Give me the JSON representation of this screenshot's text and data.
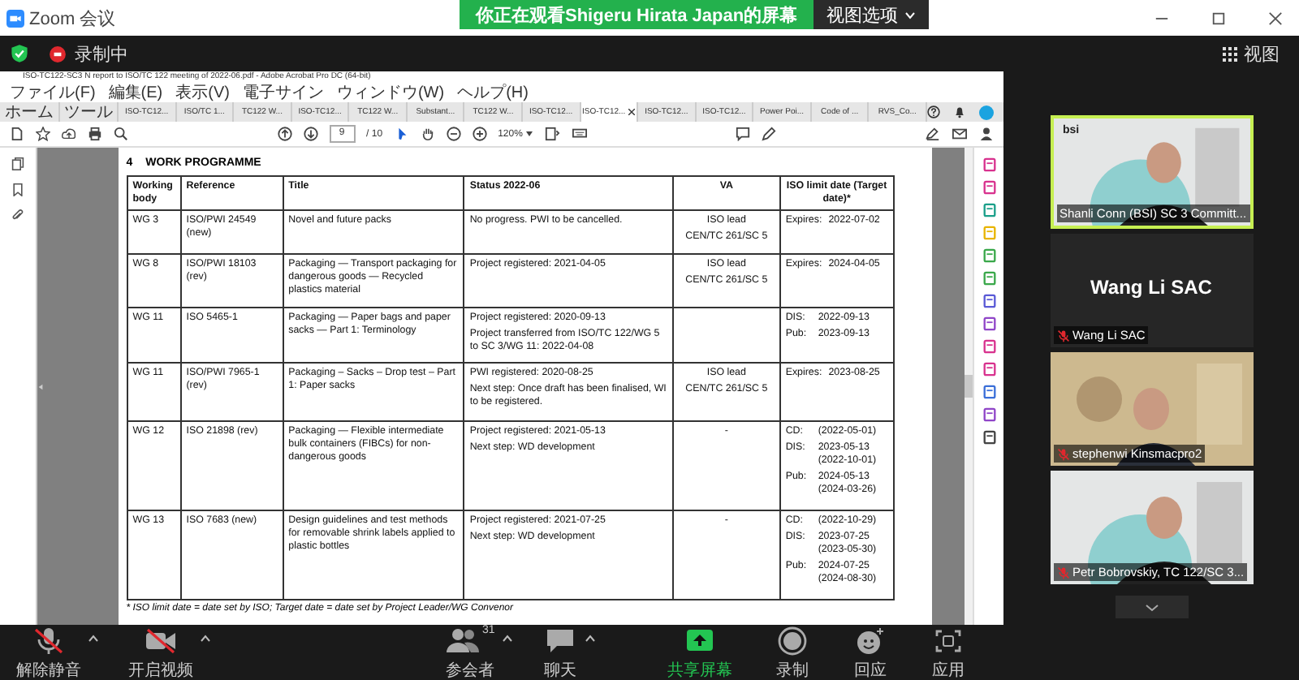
{
  "zoom_window": {
    "title": "Zoom 会议",
    "banner": "你正在观看Shigeru Hirata Japan的屏幕",
    "view_options": "视图选项",
    "recording": "录制中",
    "view": "视图"
  },
  "acrobat": {
    "title": "ISO-TC122-SC3 N report to ISO/TC 122 meeting of 2022-06.pdf - Adobe Acrobat Pro DC (64-bit)",
    "menus": [
      "ファイル(F)",
      "編集(E)",
      "表示(V)",
      "電子サイン",
      "ウィンドウ(W)",
      "ヘルプ(H)"
    ],
    "tabs": [
      {
        "label": "ホーム",
        "selected": false,
        "kind": "home"
      },
      {
        "label": "ツール",
        "selected": false,
        "kind": "home"
      },
      {
        "label": "ISO-TC12...",
        "selected": false,
        "kind": "doc"
      },
      {
        "label": "ISO/TC 1...",
        "selected": false,
        "kind": "doc"
      },
      {
        "label": "TC122 W...",
        "selected": false,
        "kind": "doc"
      },
      {
        "label": "ISO-TC12...",
        "selected": false,
        "kind": "doc"
      },
      {
        "label": "TC122 W...",
        "selected": false,
        "kind": "doc"
      },
      {
        "label": "Substant...",
        "selected": false,
        "kind": "doc"
      },
      {
        "label": "TC122 W...",
        "selected": false,
        "kind": "doc"
      },
      {
        "label": "ISO-TC12...",
        "selected": false,
        "kind": "doc"
      },
      {
        "label": "ISO-TC12...",
        "selected": true,
        "kind": "doc"
      },
      {
        "label": "ISO-TC12...",
        "selected": false,
        "kind": "doc"
      },
      {
        "label": "ISO-TC12...",
        "selected": false,
        "kind": "doc"
      },
      {
        "label": "Power Poi...",
        "selected": false,
        "kind": "doc"
      },
      {
        "label": "Code of ...",
        "selected": false,
        "kind": "doc"
      },
      {
        "label": "RVS_Co...",
        "selected": false,
        "kind": "doc"
      }
    ],
    "page_current": "9",
    "page_total": "/ 10",
    "zoom": "120%"
  },
  "document": {
    "heading_number": "4",
    "heading": "WORK PROGRAMME",
    "columns": [
      "Working body",
      "Reference",
      "Title",
      "Status 2022-06",
      "VA",
      "ISO limit date (Target date)*"
    ],
    "rows": [
      {
        "working_body": "WG 3",
        "reference": "ISO/PWI 24549 (new)",
        "title": "Novel and future packs",
        "status": [
          "No progress. PWI to be cancelled."
        ],
        "va": [
          "ISO lead",
          "CEN/TC 261/SC 5"
        ],
        "dates": [
          {
            "label": "Expires:",
            "value": "2022-07-02"
          }
        ]
      },
      {
        "working_body": "WG 8",
        "reference": "ISO/PWI 18103 (rev)",
        "title": "Packaging — Transport packaging for dangerous goods — Recycled plastics material",
        "status": [
          "Project registered: 2021-04-05"
        ],
        "va": [
          "ISO lead",
          "CEN/TC 261/SC 5"
        ],
        "dates": [
          {
            "label": "Expires:",
            "value": "2024-04-05"
          }
        ]
      },
      {
        "working_body": "WG 11",
        "reference": "ISO 5465-1",
        "title": "Packaging — Paper bags and paper sacks — Part 1: Terminology",
        "status": [
          "Project registered: 2020-09-13",
          "Project transferred from ISO/TC 122/WG 5 to SC 3/WG 11: 2022-04-08"
        ],
        "va": [],
        "dates": [
          {
            "label": "DIS:",
            "value": "2022-09-13"
          },
          {
            "label": "Pub:",
            "value": "2023-09-13"
          }
        ]
      },
      {
        "working_body": "WG 11",
        "reference": "ISO/PWI 7965-1 (rev)",
        "title": "Packaging – Sacks – Drop test – Part 1: Paper sacks",
        "status": [
          "PWI registered: 2020-08-25",
          "Next step: Once draft has been finalised, WI to be registered."
        ],
        "va": [
          "ISO lead",
          "CEN/TC 261/SC 5"
        ],
        "dates": [
          {
            "label": "Expires:",
            "value": "2023-08-25"
          }
        ]
      },
      {
        "working_body": "WG 12",
        "reference": "ISO 21898 (rev)",
        "title": "Packaging — Flexible intermediate bulk containers (FIBCs) for non-dangerous goods",
        "status": [
          "Project registered: 2021-05-13",
          "Next step: WD development"
        ],
        "va": [
          "-"
        ],
        "dates": [
          {
            "label": "CD:",
            "value": "(2022-05-01)"
          },
          {
            "label": "DIS:",
            "value": "2023-05-13",
            "target": "(2022-10-01)"
          },
          {
            "label": "Pub:",
            "value": "2024-05-13",
            "target": "(2024-03-26)"
          }
        ]
      },
      {
        "working_body": "WG 13",
        "reference": "ISO 7683 (new)",
        "title": "Design guidelines and test methods for removable shrink labels applied to plastic bottles",
        "status": [
          "Project registered: 2021-07-25",
          "Next step: WD development"
        ],
        "va": [
          "-"
        ],
        "dates": [
          {
            "label": "CD:",
            "value": "(2022-10-29)"
          },
          {
            "label": "DIS:",
            "value": "2023-07-25",
            "target": "(2023-05-30)"
          },
          {
            "label": "Pub:",
            "value": "2024-07-25",
            "target": "(2024-08-30)"
          }
        ]
      }
    ],
    "footnote": "* ISO limit date = date set by ISO; Target date = date set by Project Leader/WG Convenor"
  },
  "participants": [
    {
      "name": "Shanli Conn (BSI) SC 3 Committ...",
      "kind": "video",
      "speaking": true,
      "muted": false,
      "logo": "bsi"
    },
    {
      "name": "Wang Li SAC",
      "kind": "name_only",
      "speaking": false,
      "muted": true,
      "display": "Wang Li SAC"
    },
    {
      "name": "stephenwi Kinsmacpro2",
      "kind": "video",
      "speaking": false,
      "muted": true
    },
    {
      "name": "Petr Bobrovskiy, TC 122/SC 3...",
      "kind": "video",
      "speaking": false,
      "muted": true
    }
  ],
  "toolbar": [
    {
      "label": "解除静音",
      "kind": "mic",
      "off": true,
      "menu": true
    },
    {
      "label": "开启视频",
      "kind": "video",
      "off": true,
      "menu": true
    },
    {
      "label": "参会者",
      "kind": "people",
      "count": "31",
      "menu": true
    },
    {
      "label": "聊天",
      "kind": "chat",
      "menu": true
    },
    {
      "label": "共享屏幕",
      "kind": "share",
      "active": true
    },
    {
      "label": "录制",
      "kind": "record"
    },
    {
      "label": "回应",
      "kind": "react"
    },
    {
      "label": "应用",
      "kind": "apps"
    }
  ]
}
